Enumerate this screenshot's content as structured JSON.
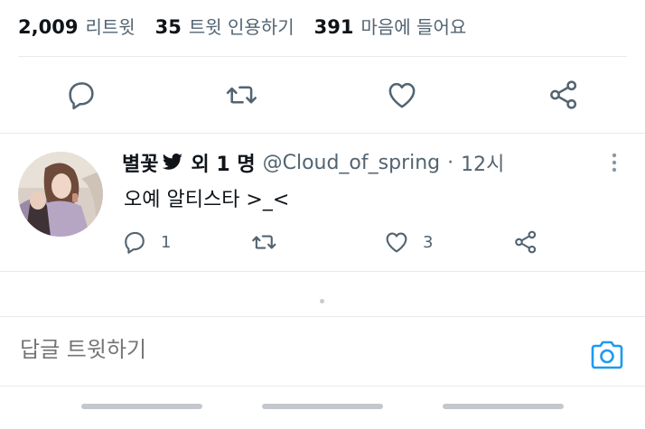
{
  "stats": {
    "retweets": {
      "count": "2,009",
      "label": "리트윗"
    },
    "quotes": {
      "count": "35",
      "label": "트윗 인용하기"
    },
    "likes": {
      "count": "391",
      "label": "마음에 들어요"
    }
  },
  "reply": {
    "display_name": "별꽃",
    "extra": "외 1 명",
    "handle": "@Cloud_of_spring",
    "dot": "·",
    "time": "12시",
    "text": "오예 알티스타 >_<",
    "reply_count": "1",
    "like_count": "3"
  },
  "compose": {
    "placeholder": "답글 트윗하기"
  },
  "colors": {
    "accent": "#1d9bf0",
    "muted": "#536471",
    "text": "#0f1419",
    "divider": "#e7ebee"
  },
  "icons": [
    "reply-icon",
    "retweet-icon",
    "like-icon",
    "share-icon",
    "bird-icon",
    "more-icon",
    "camera-icon"
  ]
}
